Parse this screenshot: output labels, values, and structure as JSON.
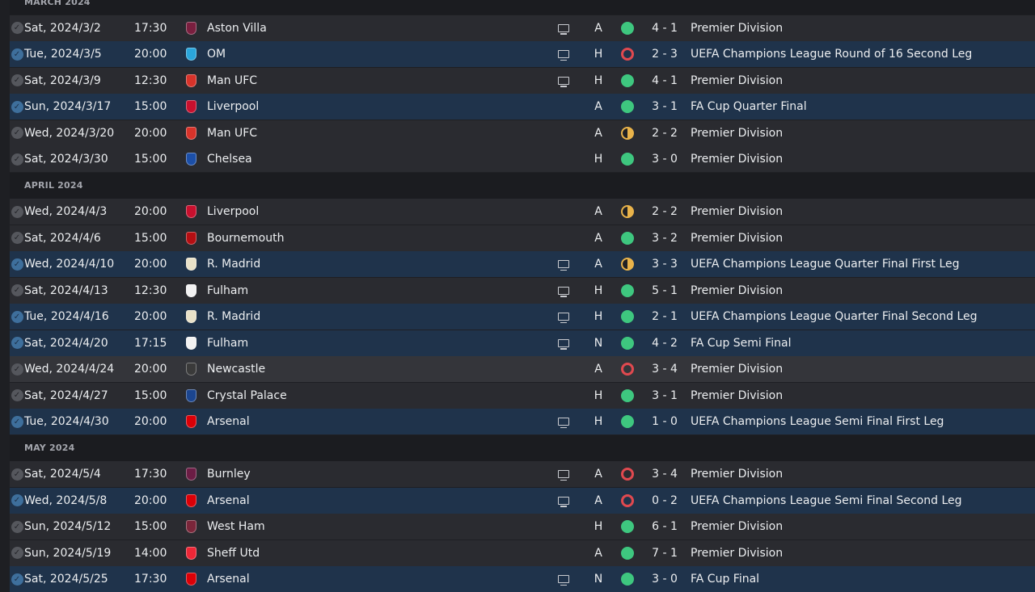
{
  "colors": {
    "background": "#1e1f23",
    "row": "#2a2b30",
    "row_european": "#1f334b",
    "row_highlight": "#34353a",
    "win": "#3ec77f",
    "loss": "#e0494f",
    "draw": "#e9b34a"
  },
  "icons": {
    "check": "check-circle-icon",
    "tv": "tv-icon",
    "win": "win-dot-icon",
    "loss": "loss-ring-icon",
    "draw": "draw-half-icon"
  },
  "months": [
    {
      "label": "MARCH 2024",
      "matches": [
        {
          "date": "Sat, 2024/3/2",
          "time": "17:30",
          "team": "Aston Villa",
          "crest_color": "#7a1f3f",
          "tv": true,
          "venue": "A",
          "result": "win",
          "score": "4 - 1",
          "competition": "Premier Division",
          "row_style": "normal"
        },
        {
          "date": "Tue, 2024/3/5",
          "time": "20:00",
          "team": "OM",
          "crest_color": "#2aa6dc",
          "tv": true,
          "venue": "H",
          "result": "loss",
          "score": "2 - 3",
          "competition": "UEFA Champions League Round of 16 Second Leg",
          "row_style": "euro"
        },
        {
          "date": "Sat, 2024/3/9",
          "time": "12:30",
          "team": "Man UFC",
          "crest_color": "#d8332a",
          "tv": true,
          "venue": "H",
          "result": "win",
          "score": "4 - 1",
          "competition": "Premier Division",
          "row_style": "normal"
        },
        {
          "date": "Sun, 2024/3/17",
          "time": "15:00",
          "team": "Liverpool",
          "crest_color": "#c8102e",
          "tv": false,
          "venue": "A",
          "result": "win",
          "score": "3 - 1",
          "competition": "FA Cup Quarter Final",
          "row_style": "euro"
        },
        {
          "date": "Wed, 2024/3/20",
          "time": "20:00",
          "team": "Man UFC",
          "crest_color": "#d8332a",
          "tv": false,
          "venue": "A",
          "result": "draw",
          "score": "2 - 2",
          "competition": "Premier Division",
          "row_style": "normal"
        },
        {
          "date": "Sat, 2024/3/30",
          "time": "15:00",
          "team": "Chelsea",
          "crest_color": "#1c4fa8",
          "tv": false,
          "venue": "H",
          "result": "win",
          "score": "3 - 0",
          "competition": "Premier Division",
          "row_style": "normal"
        }
      ]
    },
    {
      "label": "APRIL 2024",
      "matches": [
        {
          "date": "Wed, 2024/4/3",
          "time": "20:00",
          "team": "Liverpool",
          "crest_color": "#c8102e",
          "tv": false,
          "venue": "A",
          "result": "draw",
          "score": "2 - 2",
          "competition": "Premier Division",
          "row_style": "normal"
        },
        {
          "date": "Sat, 2024/4/6",
          "time": "15:00",
          "team": "Bournemouth",
          "crest_color": "#b50e12",
          "tv": false,
          "venue": "A",
          "result": "win",
          "score": "3 - 2",
          "competition": "Premier Division",
          "row_style": "normal"
        },
        {
          "date": "Wed, 2024/4/10",
          "time": "20:00",
          "team": "R. Madrid",
          "crest_color": "#e8e1c8",
          "tv": true,
          "venue": "A",
          "result": "draw",
          "score": "3 - 3",
          "competition": "UEFA Champions League Quarter Final First Leg",
          "row_style": "euro"
        },
        {
          "date": "Sat, 2024/4/13",
          "time": "12:30",
          "team": "Fulham",
          "crest_color": "#f2f2f2",
          "tv": true,
          "venue": "H",
          "result": "win",
          "score": "5 - 1",
          "competition": "Premier Division",
          "row_style": "normal"
        },
        {
          "date": "Tue, 2024/4/16",
          "time": "20:00",
          "team": "R. Madrid",
          "crest_color": "#e8e1c8",
          "tv": true,
          "venue": "H",
          "result": "win",
          "score": "2 - 1",
          "competition": "UEFA Champions League Quarter Final Second Leg",
          "row_style": "euro"
        },
        {
          "date": "Sat, 2024/4/20",
          "time": "17:15",
          "team": "Fulham",
          "crest_color": "#f2f2f2",
          "tv": true,
          "venue": "N",
          "result": "win",
          "score": "4 - 2",
          "competition": "FA Cup Semi Final",
          "row_style": "euro"
        },
        {
          "date": "Wed, 2024/4/24",
          "time": "20:00",
          "team": "Newcastle",
          "crest_color": "#3a3a3a",
          "tv": false,
          "venue": "A",
          "result": "loss",
          "score": "3 - 4",
          "competition": "Premier Division",
          "row_style": "highlight"
        },
        {
          "date": "Sat, 2024/4/27",
          "time": "15:00",
          "team": "Crystal Palace",
          "crest_color": "#1b458f",
          "tv": false,
          "venue": "H",
          "result": "win",
          "score": "3 - 1",
          "competition": "Premier Division",
          "row_style": "normal"
        },
        {
          "date": "Tue, 2024/4/30",
          "time": "20:00",
          "team": "Arsenal",
          "crest_color": "#db0007",
          "tv": true,
          "venue": "H",
          "result": "win",
          "score": "1 - 0",
          "competition": "UEFA Champions League Semi Final First Leg",
          "row_style": "euro"
        }
      ]
    },
    {
      "label": "MAY 2024",
      "matches": [
        {
          "date": "Sat, 2024/5/4",
          "time": "17:30",
          "team": "Burnley",
          "crest_color": "#6c1d45",
          "tv": true,
          "venue": "A",
          "result": "loss",
          "score": "3 - 4",
          "competition": "Premier Division",
          "row_style": "normal"
        },
        {
          "date": "Wed, 2024/5/8",
          "time": "20:00",
          "team": "Arsenal",
          "crest_color": "#db0007",
          "tv": true,
          "venue": "A",
          "result": "loss",
          "score": "0 - 2",
          "competition": "UEFA Champions League Semi Final Second Leg",
          "row_style": "euro"
        },
        {
          "date": "Sun, 2024/5/12",
          "time": "15:00",
          "team": "West Ham",
          "crest_color": "#7a263a",
          "tv": false,
          "venue": "H",
          "result": "win",
          "score": "6 - 1",
          "competition": "Premier Division",
          "row_style": "normal"
        },
        {
          "date": "Sun, 2024/5/19",
          "time": "14:00",
          "team": "Sheff Utd",
          "crest_color": "#ee2737",
          "tv": false,
          "venue": "A",
          "result": "win",
          "score": "7 - 1",
          "competition": "Premier Division",
          "row_style": "normal"
        },
        {
          "date": "Sat, 2024/5/25",
          "time": "17:30",
          "team": "Arsenal",
          "crest_color": "#db0007",
          "tv": true,
          "venue": "N",
          "result": "win",
          "score": "3 - 0",
          "competition": "FA Cup Final",
          "row_style": "euro"
        }
      ]
    }
  ]
}
